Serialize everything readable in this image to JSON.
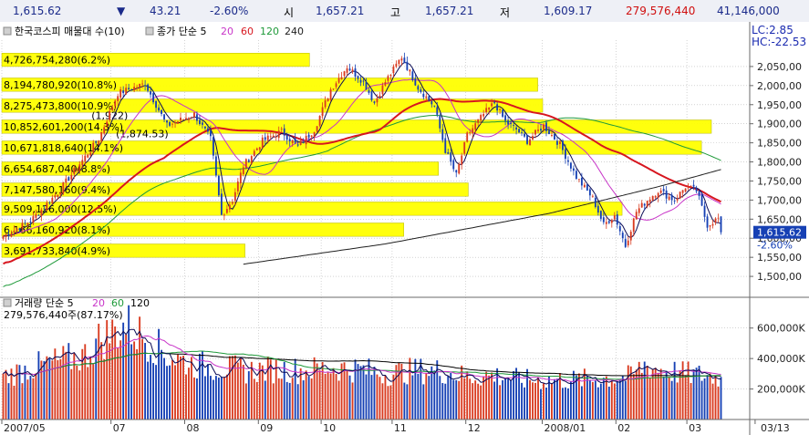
{
  "topbar": {
    "price": "1,615.62",
    "change_arrow": "▼",
    "change": "43.21",
    "change_pct": "-2.60%",
    "open_label": "시",
    "open": "1,657.21",
    "high_label": "고",
    "high": "1,657.21",
    "low_label": "저",
    "low": "1,609.17",
    "volume": "279,576,440",
    "amount": "41,146,000"
  },
  "price_panel": {
    "legend_left": "한국코스피 매물대 수(10)",
    "legend_ma_label": "종가 단순 5",
    "legend_ma": [
      "20",
      "60",
      "120",
      "240"
    ],
    "lc": "LC:2.85",
    "hc": "HC:-22.53",
    "current_price": "1,615.62",
    "current_pct": "-2.60%"
  },
  "volume_panel": {
    "legend_label": "거래량 단순 5",
    "legend_ma": [
      "20",
      "60",
      "120"
    ],
    "info": "279,576,440주(87.17%)"
  },
  "volume_profile": [
    {
      "label": "4,726,754,280(6.2%)",
      "low": 2050,
      "high": 2085,
      "pct": 6.2
    },
    {
      "label": "8,194,780,920(10.8%)",
      "low": 1985,
      "high": 2020,
      "pct": 10.8
    },
    {
      "label": "8,275,473,800(10.9%)",
      "low": 1930,
      "high": 1965,
      "pct": 10.9
    },
    {
      "label": "10,852,601,200(14.3%)",
      "low": 1875,
      "high": 1910,
      "pct": 14.3
    },
    {
      "label": "10,671,818,640(14.1%)",
      "low": 1820,
      "high": 1855,
      "pct": 14.1
    },
    {
      "label": "6,654,687,040(8.8%)",
      "low": 1765,
      "high": 1800,
      "pct": 8.8
    },
    {
      "label": "7,147,580,160(9.4%)",
      "low": 1710,
      "high": 1745,
      "pct": 9.4
    },
    {
      "label": "9,509,126,000(12.5%)",
      "low": 1660,
      "high": 1695,
      "pct": 12.5
    },
    {
      "label": "6,166,160,920(8.1%)",
      "low": 1605,
      "high": 1640,
      "pct": 8.1
    },
    {
      "label": "3,691,733,840(4.9%)",
      "low": 1550,
      "high": 1585,
      "pct": 4.9
    }
  ],
  "chart_annotations": [
    {
      "text": "1,922",
      "date_index": 37,
      "value": 1922
    },
    {
      "text": "1,874.53",
      "date_index": 46,
      "value": 1874.53
    }
  ],
  "chart_data": {
    "type": "candlestick",
    "price_axis": {
      "ylim": [
        1450,
        2100
      ],
      "ticks": [
        "2,050,00",
        "2,000,00",
        "1,950,00",
        "1,900,00",
        "1,850,00",
        "1,800,00",
        "1,750,00",
        "1,700,00",
        "1,650,00",
        "1,600,00",
        "1,550,00",
        "1,500,00"
      ],
      "tick_values": [
        2050,
        2000,
        1950,
        1900,
        1850,
        1800,
        1750,
        1700,
        1650,
        1600,
        1550,
        1500
      ]
    },
    "volume_axis": {
      "ylim": [
        0,
        730000
      ],
      "ticks": [
        "600,000K",
        "400,000K",
        "200,000K"
      ],
      "tick_values": [
        600000,
        400000,
        200000
      ],
      "unit": "K"
    },
    "x_axis": {
      "labels": [
        "2007/05",
        "07",
        "08",
        "09",
        "10",
        "11",
        "12",
        "2008/01",
        "02",
        "03",
        "03/13"
      ],
      "label_index": [
        0,
        40,
        67,
        94,
        117,
        143,
        170,
        198,
        225,
        251,
        276
      ]
    },
    "n_bars": 264,
    "price_anchors": [
      [
        0,
        1605
      ],
      [
        10,
        1645
      ],
      [
        20,
        1720
      ],
      [
        35,
        1860
      ],
      [
        42,
        1980
      ],
      [
        52,
        2005
      ],
      [
        60,
        1895
      ],
      [
        70,
        1925
      ],
      [
        76,
        1860
      ],
      [
        80,
        1660
      ],
      [
        84,
        1700
      ],
      [
        88,
        1790
      ],
      [
        95,
        1855
      ],
      [
        102,
        1880
      ],
      [
        108,
        1840
      ],
      [
        114,
        1885
      ],
      [
        120,
        1990
      ],
      [
        126,
        2050
      ],
      [
        132,
        2010
      ],
      [
        136,
        1955
      ],
      [
        140,
        2010
      ],
      [
        146,
        2075
      ],
      [
        152,
        1995
      ],
      [
        158,
        1945
      ],
      [
        162,
        1830
      ],
      [
        166,
        1765
      ],
      [
        170,
        1870
      ],
      [
        176,
        1925
      ],
      [
        180,
        1955
      ],
      [
        184,
        1905
      ],
      [
        188,
        1885
      ],
      [
        192,
        1855
      ],
      [
        198,
        1895
      ],
      [
        204,
        1845
      ],
      [
        210,
        1760
      ],
      [
        216,
        1705
      ],
      [
        220,
        1635
      ],
      [
        224,
        1660
      ],
      [
        228,
        1580
      ],
      [
        232,
        1670
      ],
      [
        236,
        1700
      ],
      [
        240,
        1725
      ],
      [
        246,
        1700
      ],
      [
        250,
        1735
      ],
      [
        254,
        1725
      ],
      [
        258,
        1635
      ],
      [
        262,
        1652
      ],
      [
        263,
        1616
      ]
    ],
    "ma_240": [
      [
        88,
        1532
      ],
      [
        140,
        1585
      ],
      [
        200,
        1665
      ],
      [
        240,
        1735
      ],
      [
        263,
        1780
      ]
    ],
    "volume_anchors": [
      [
        0,
        280000
      ],
      [
        10,
        340000
      ],
      [
        20,
        380000
      ],
      [
        30,
        420000
      ],
      [
        35,
        520000
      ],
      [
        45,
        620000
      ],
      [
        55,
        500000
      ],
      [
        60,
        420000
      ],
      [
        70,
        360000
      ],
      [
        80,
        340000
      ],
      [
        90,
        320000
      ],
      [
        100,
        330000
      ],
      [
        110,
        320000
      ],
      [
        120,
        340000
      ],
      [
        130,
        330000
      ],
      [
        140,
        300000
      ],
      [
        150,
        320000
      ],
      [
        160,
        320000
      ],
      [
        170,
        280000
      ],
      [
        180,
        290000
      ],
      [
        190,
        260000
      ],
      [
        200,
        260000
      ],
      [
        210,
        260000
      ],
      [
        220,
        270000
      ],
      [
        230,
        280000
      ],
      [
        235,
        360000
      ],
      [
        240,
        330000
      ],
      [
        250,
        300000
      ],
      [
        263,
        279576
      ]
    ]
  },
  "colors": {
    "up": "#d93a1f",
    "down": "#1640b4",
    "ma5": "#0b0b55",
    "ma20": "#c835c8",
    "ma60": "#d7161f",
    "ma120": "#1f9a3a",
    "ma240": "#202020",
    "profile": "#ffff00",
    "axis_text": "#222222"
  }
}
